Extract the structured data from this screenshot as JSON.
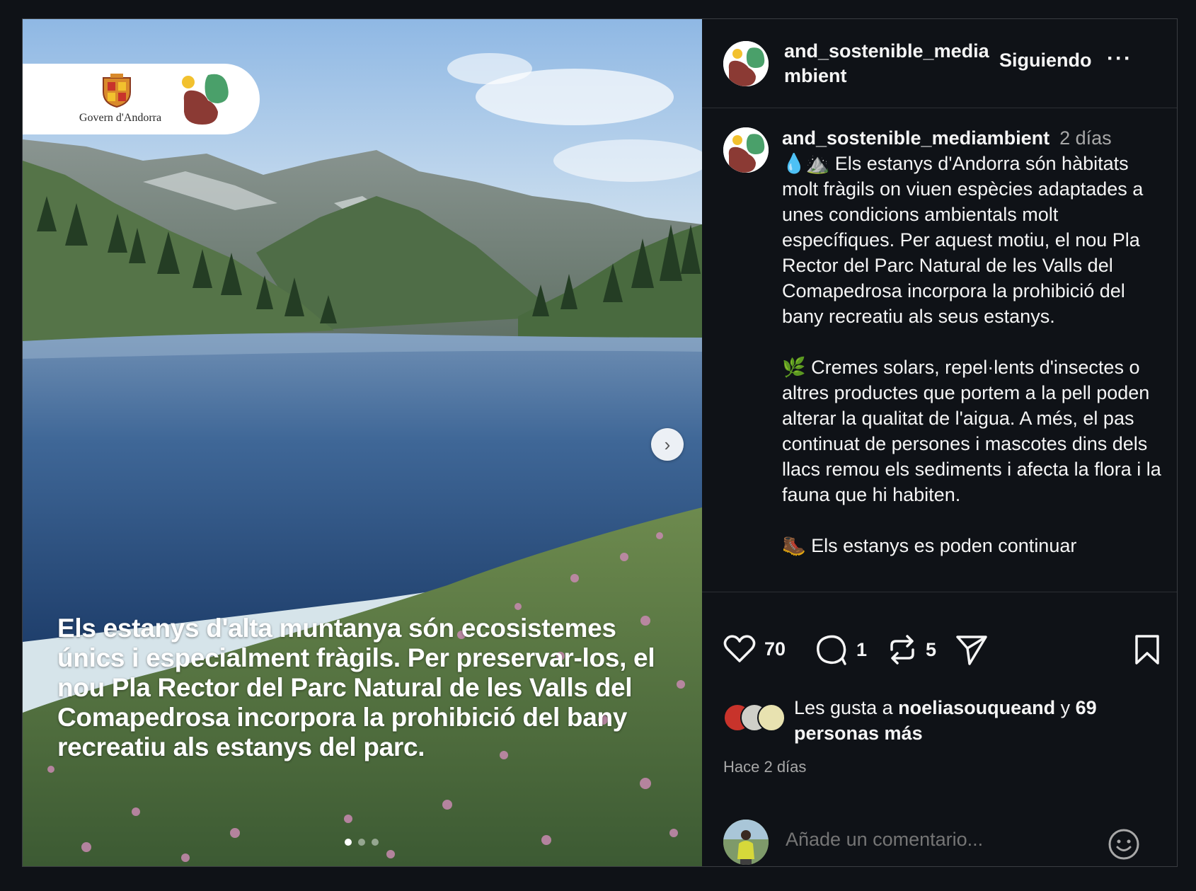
{
  "post": {
    "brand": {
      "government_text": "Govern d'Andorra"
    },
    "overlay_text": "Els estanys d'alta muntanya són ecosistemes únics i especialment fràgils. Per preservar-los, el nou Pla Rector del Parc Natural de les Valls del Comapedrosa incorpora la prohibició del bany recreatiu als estanys del parc.",
    "carousel": {
      "total_slides": 3,
      "active_index": 0,
      "next_icon": "chevron-right-icon"
    }
  },
  "header": {
    "username_line1": "and_sostenible_media",
    "username_line2": "mbient",
    "follow_label": "Siguiendo",
    "more_label": "···"
  },
  "caption": {
    "username": "and_sostenible_mediambient",
    "time": "2 días",
    "paragraphs": [
      "💧⛰️ Els estanys d'Andorra són hàbitats molt fràgils on viuen espècies adaptades a unes condicions ambientals molt específiques. Per aquest motiu, el nou Pla Rector del Parc Natural de les Valls del Comapedrosa incorpora la prohibició del bany recreatiu als seus estanys.",
      "🌿 Cremes solars, repel·lents d'insectes o altres productes que portem a la pell poden alterar la qualitat de l'aigua. A més, el pas continuat de persones i mascotes dins dels llacs remou els sediments i afecta la flora i la fauna que hi habiten.",
      "🥾 Els estanys es poden continuar"
    ]
  },
  "actions": {
    "like_count": "70",
    "comment_count": "1",
    "repost_count": "5",
    "icons": [
      "heart-icon",
      "comment-icon",
      "repost-icon",
      "share-icon",
      "bookmark-icon"
    ]
  },
  "likes": {
    "prefix": "Les gusta a ",
    "user": "noeliasouqueand",
    "middle": " y ",
    "others": "69 personas más"
  },
  "timestamp": "Hace 2 días",
  "comment": {
    "placeholder": "Añade un comentario...",
    "emoji_icon": "smiley-icon"
  },
  "colors": {
    "background": "#0f1217",
    "text": "#f5f5f5",
    "muted": "#a8a8a8",
    "logo_red": "#8b3a34",
    "logo_green": "#4aa06a",
    "logo_yellow": "#f2c12e"
  }
}
